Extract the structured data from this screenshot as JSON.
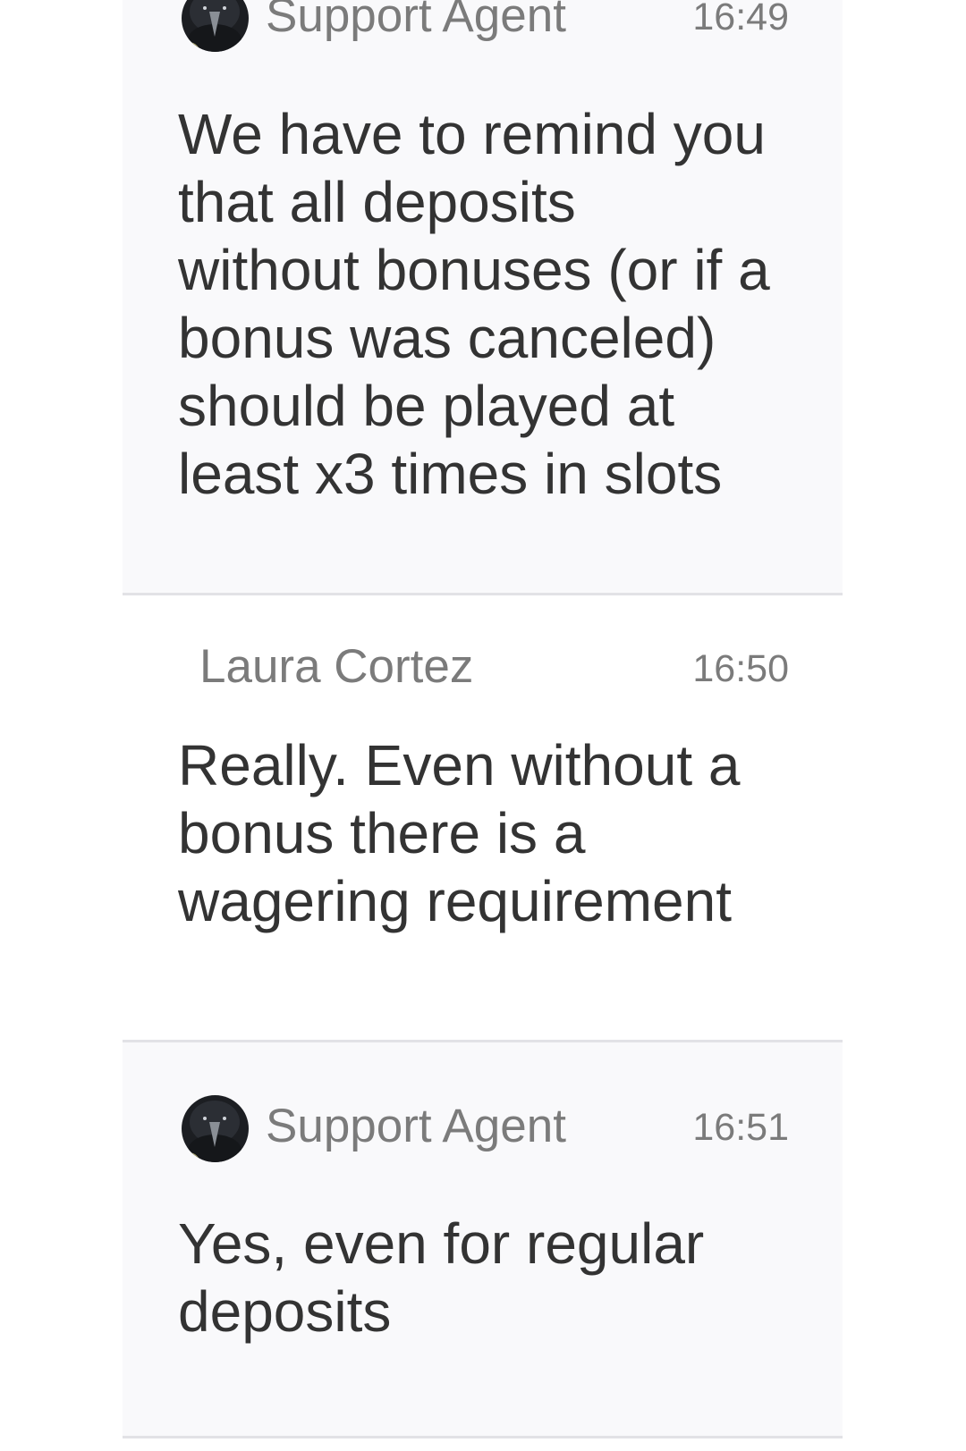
{
  "messages": [
    {
      "sender": "Support Agent",
      "time": "16:49",
      "avatar": "raven-avatar-icon",
      "text": "We have to remind you\nthat all deposits\nwithout bonuses (or if a\nbonus was canceled)\nshould be played at\nleast x3 times in slots"
    },
    {
      "sender": "Laura Cortez",
      "time": "16:50",
      "text": "Really. Even without a\nbonus there is a\nwagering requirement"
    },
    {
      "sender": "Support Agent",
      "time": "16:51",
      "avatar": "raven-avatar-icon",
      "text": "Yes, even for regular\ndeposits"
    }
  ],
  "colors": {
    "agent_background": "#f9f9fb",
    "user_background": "#ffffff",
    "divider": "#e2e2e6",
    "meta_text": "#7b7b7b",
    "body_text": "#333333"
  }
}
